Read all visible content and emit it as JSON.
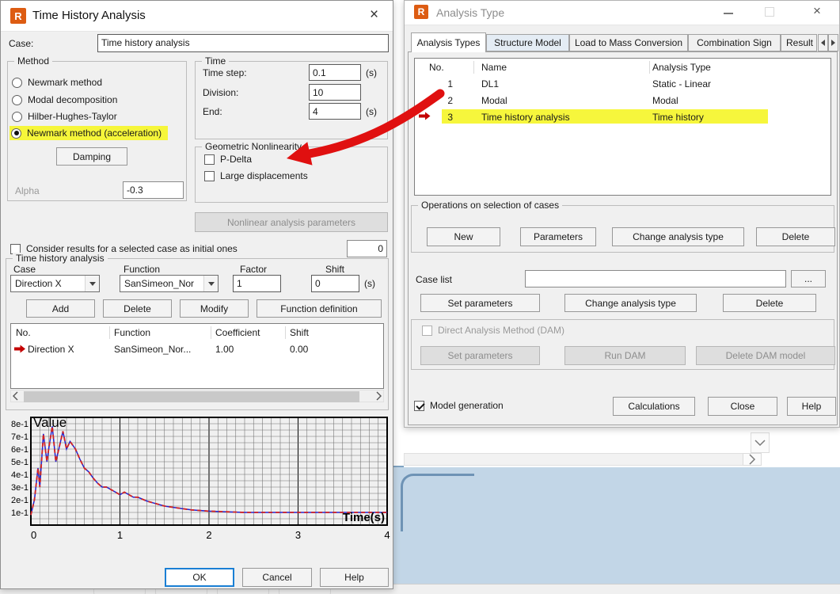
{
  "tha_dialog": {
    "title": "Time History Analysis",
    "controls": {
      "close": "×"
    },
    "case": {
      "label": "Case:",
      "value": "Time history analysis"
    },
    "method": {
      "legend": "Method",
      "options": [
        {
          "label": "Newmark method",
          "selected": false,
          "highlighted": false
        },
        {
          "label": "Modal decomposition",
          "selected": false,
          "highlighted": false
        },
        {
          "label": "Hilber-Hughes-Taylor",
          "selected": false,
          "highlighted": false
        },
        {
          "label": "Newmark method (acceleration)",
          "selected": true,
          "highlighted": true
        }
      ],
      "damping_button": "Damping",
      "alpha": {
        "label": "Alpha",
        "value": "-0.3"
      }
    },
    "time": {
      "legend": "Time",
      "fields": [
        {
          "label": "Time step:",
          "value": "0.1",
          "unit": "(s)"
        },
        {
          "label": "Division:",
          "value": "10",
          "unit": ""
        },
        {
          "label": "End:",
          "value": "4",
          "unit": "(s)"
        }
      ]
    },
    "geometric": {
      "legend": "Geometric Nonlinearity",
      "checkboxes": [
        {
          "label": "P-Delta",
          "checked": false
        },
        {
          "label": "Large displacements",
          "checked": false
        }
      ]
    },
    "nonlinear_button": "Nonlinear analysis parameters",
    "initial_case": {
      "label": "Consider results for a selected case as initial ones",
      "checked": false,
      "value": "0"
    },
    "tha_group": {
      "legend": "Time history analysis",
      "column_labels": [
        "Case",
        "Function",
        "Factor",
        "Shift"
      ],
      "case_select": "Direction X",
      "function_select": "SanSimeon_Nor",
      "factor_value": "1",
      "shift_value": "0",
      "shift_unit": "(s)",
      "buttons": [
        "Add",
        "Delete",
        "Modify",
        "Function definition"
      ],
      "table": {
        "headers": [
          "No.",
          "Function",
          "Coefficient",
          "Shift"
        ],
        "rows": [
          {
            "no": "Direction X",
            "function": "SanSimeon_Nor...",
            "coefficient": "1.00",
            "shift": "0.00",
            "marked": true
          }
        ]
      }
    },
    "footer_buttons": [
      "OK",
      "Cancel",
      "Help"
    ]
  },
  "chart_data": {
    "type": "line",
    "title": "Value",
    "xlabel": "Time(s)",
    "ylabel": "Value",
    "xlim": [
      0,
      4
    ],
    "ylim": [
      0,
      0.85
    ],
    "x_ticks": [
      "0",
      "1",
      "2",
      "3",
      "4"
    ],
    "y_ticks": [
      "1e-1",
      "2e-1",
      "3e-1",
      "4e-1",
      "5e-1",
      "6e-1",
      "7e-1",
      "8e-1"
    ],
    "grid": true,
    "legend": "none",
    "series_colors": {
      "solid": "#2323cf",
      "dashed": "#d22222"
    },
    "points": [
      [
        0,
        0.08
      ],
      [
        0.04,
        0.2
      ],
      [
        0.08,
        0.45
      ],
      [
        0.1,
        0.3
      ],
      [
        0.14,
        0.72
      ],
      [
        0.18,
        0.5
      ],
      [
        0.2,
        0.6
      ],
      [
        0.24,
        0.78
      ],
      [
        0.28,
        0.5
      ],
      [
        0.32,
        0.62
      ],
      [
        0.36,
        0.74
      ],
      [
        0.4,
        0.6
      ],
      [
        0.44,
        0.66
      ],
      [
        0.5,
        0.6
      ],
      [
        0.55,
        0.52
      ],
      [
        0.6,
        0.45
      ],
      [
        0.65,
        0.42
      ],
      [
        0.7,
        0.37
      ],
      [
        0.75,
        0.33
      ],
      [
        0.8,
        0.3
      ],
      [
        0.85,
        0.3
      ],
      [
        0.9,
        0.28
      ],
      [
        0.95,
        0.26
      ],
      [
        1.0,
        0.24
      ],
      [
        1.05,
        0.26
      ],
      [
        1.1,
        0.24
      ],
      [
        1.15,
        0.22
      ],
      [
        1.2,
        0.22
      ],
      [
        1.3,
        0.19
      ],
      [
        1.4,
        0.17
      ],
      [
        1.5,
        0.15
      ],
      [
        1.6,
        0.14
      ],
      [
        1.7,
        0.13
      ],
      [
        1.8,
        0.12
      ],
      [
        1.9,
        0.115
      ],
      [
        2.0,
        0.11
      ],
      [
        2.2,
        0.105
      ],
      [
        2.4,
        0.1
      ],
      [
        2.6,
        0.1
      ],
      [
        2.8,
        0.1
      ],
      [
        3.0,
        0.1
      ],
      [
        3.2,
        0.1
      ],
      [
        3.4,
        0.1
      ],
      [
        3.6,
        0.1
      ],
      [
        3.8,
        0.1
      ],
      [
        4.0,
        0.1
      ]
    ]
  },
  "analysis_dialog": {
    "title": "Analysis Type",
    "controls": {
      "close": "×"
    },
    "tabs": [
      {
        "label": "Analysis Types",
        "active": true
      },
      {
        "label": "Structure Model",
        "active": false
      },
      {
        "label": "Load to Mass Conversion",
        "active": false
      },
      {
        "label": "Combination Sign",
        "active": false
      },
      {
        "label": "Result",
        "active": false
      }
    ],
    "cases_table": {
      "headers": [
        "No.",
        "Name",
        "Analysis Type"
      ],
      "rows": [
        {
          "no": "1",
          "name": "DL1",
          "type": "Static - Linear",
          "marked": false,
          "highlighted": false
        },
        {
          "no": "2",
          "name": "Modal",
          "type": "Modal",
          "marked": false,
          "highlighted": false
        },
        {
          "no": "3",
          "name": "Time history analysis",
          "type": "Time history",
          "marked": true,
          "highlighted": true
        }
      ]
    },
    "operations": {
      "legend": "Operations on selection of cases",
      "buttons": [
        "New",
        "Parameters",
        "Change analysis type",
        "Delete"
      ]
    },
    "case_list": {
      "label": "Case list",
      "value": "",
      "browse_button": "..."
    },
    "case_list_buttons": [
      "Set parameters",
      "Change analysis type",
      "Delete"
    ],
    "dam": {
      "checkbox_label": "Direct Analysis Method (DAM)",
      "checked": false,
      "buttons": [
        "Set parameters",
        "Run DAM",
        "Delete DAM model"
      ]
    },
    "model_generation": {
      "label": "Model generation",
      "checked": true
    },
    "footer_buttons": [
      "Calculations",
      "Close",
      "Help"
    ]
  }
}
